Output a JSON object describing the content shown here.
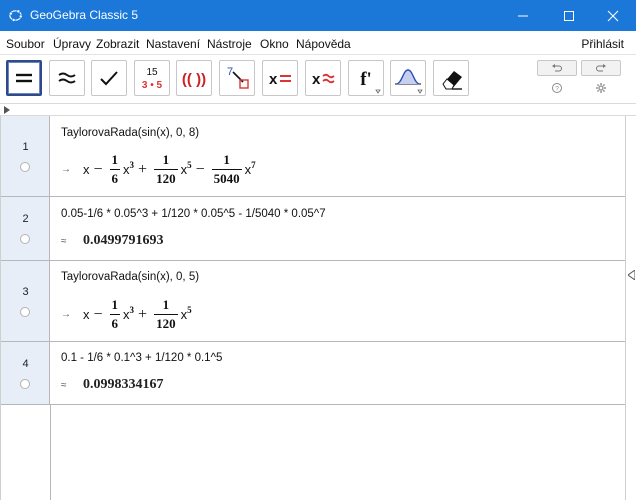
{
  "window": {
    "title": "GeoGebra Classic 5",
    "controls": [
      "minimize-icon",
      "maximize-icon",
      "close-icon"
    ]
  },
  "menu": {
    "items": [
      "Soubor",
      "Úpravy",
      "Zobrazit",
      "Nastavení",
      "Nástroje",
      "Okno",
      "Nápověda"
    ],
    "login": "Přihlásit"
  },
  "toolbar": {
    "tools": [
      {
        "icon": "evaluate-icon",
        "active": true
      },
      {
        "icon": "numeric-icon"
      },
      {
        "icon": "keep-input-icon"
      },
      {
        "icon": "factor-icon",
        "top": "15",
        "bottom": "3 • 5"
      },
      {
        "icon": "expand-icon",
        "glyph": "(( ))"
      },
      {
        "icon": "substitute-icon",
        "glyph": "7"
      },
      {
        "icon": "solve-icon",
        "glyph": "x="
      },
      {
        "icon": "solve-numerically-icon",
        "glyph": "x≈"
      },
      {
        "icon": "derivative-icon",
        "glyph": "f'"
      },
      {
        "icon": "probability-icon"
      },
      {
        "icon": "delete-icon"
      }
    ],
    "utility": [
      "undo-icon",
      "redo-icon",
      "help-icon",
      "settings-icon"
    ]
  },
  "rows": [
    {
      "number": "1",
      "input": "TaylorovaRada(sin(x), 0, 8)",
      "marker": "→",
      "output": {
        "terms": [
          {
            "var": "x"
          },
          {
            "op": "−",
            "num": "1",
            "den": "6",
            "var": "x",
            "exp": "3"
          },
          {
            "op": "+",
            "num": "1",
            "den": "120",
            "var": "x",
            "exp": "5"
          },
          {
            "op": "−",
            "num": "1",
            "den": "5040",
            "var": "x",
            "exp": "7"
          }
        ]
      }
    },
    {
      "number": "2",
      "input": "0.05-1/6 * 0.05^3 + 1/120 * 0.05^5 - 1/5040 * 0.05^7",
      "marker": "≈",
      "output": {
        "value": "0.0499791693"
      }
    },
    {
      "number": "3",
      "input": "TaylorovaRada(sin(x), 0, 5)",
      "marker": "→",
      "output": {
        "terms": [
          {
            "var": "x"
          },
          {
            "op": "−",
            "num": "1",
            "den": "6",
            "var": "x",
            "exp": "3"
          },
          {
            "op": "+",
            "num": "1",
            "den": "120",
            "var": "x",
            "exp": "5"
          }
        ]
      }
    },
    {
      "number": "4",
      "input": "0.1 - 1/6 * 0.1^3 + 1/120 * 0.1^5",
      "marker": "≈",
      "output": {
        "value": "0.0998334167"
      }
    }
  ]
}
